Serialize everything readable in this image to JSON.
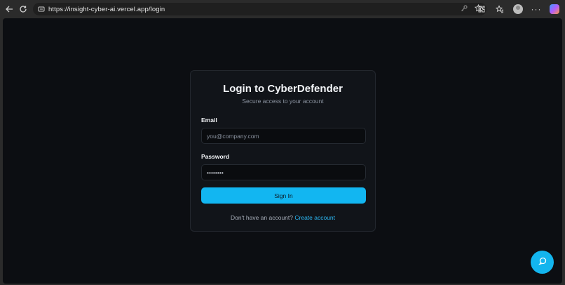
{
  "browser": {
    "url": "https://insight-cyber-ai.vercel.app/login"
  },
  "login": {
    "title": "Login to CyberDefender",
    "subtitle": "Secure access to your account",
    "email_label": "Email",
    "email_placeholder": "you@company.com",
    "email_value": "",
    "password_label": "Password",
    "password_value": "••••••••",
    "submit_label": "Sign In",
    "footer_text": "Don't have an account?",
    "footer_link": "Create account"
  },
  "colors": {
    "accent": "#12b6f1",
    "background": "#0c0e12",
    "card": "#111419"
  },
  "icons": {
    "back": "back-arrow-icon",
    "refresh": "refresh-icon",
    "site_info": "site-info-icon",
    "key": "key-icon",
    "favorite": "star-icon",
    "extensions": "extensions-icon",
    "favorites": "favorites-icon",
    "profile": "profile-avatar",
    "more": "more-icon",
    "copilot": "copilot-icon",
    "chat": "chat-bubble-icon"
  }
}
